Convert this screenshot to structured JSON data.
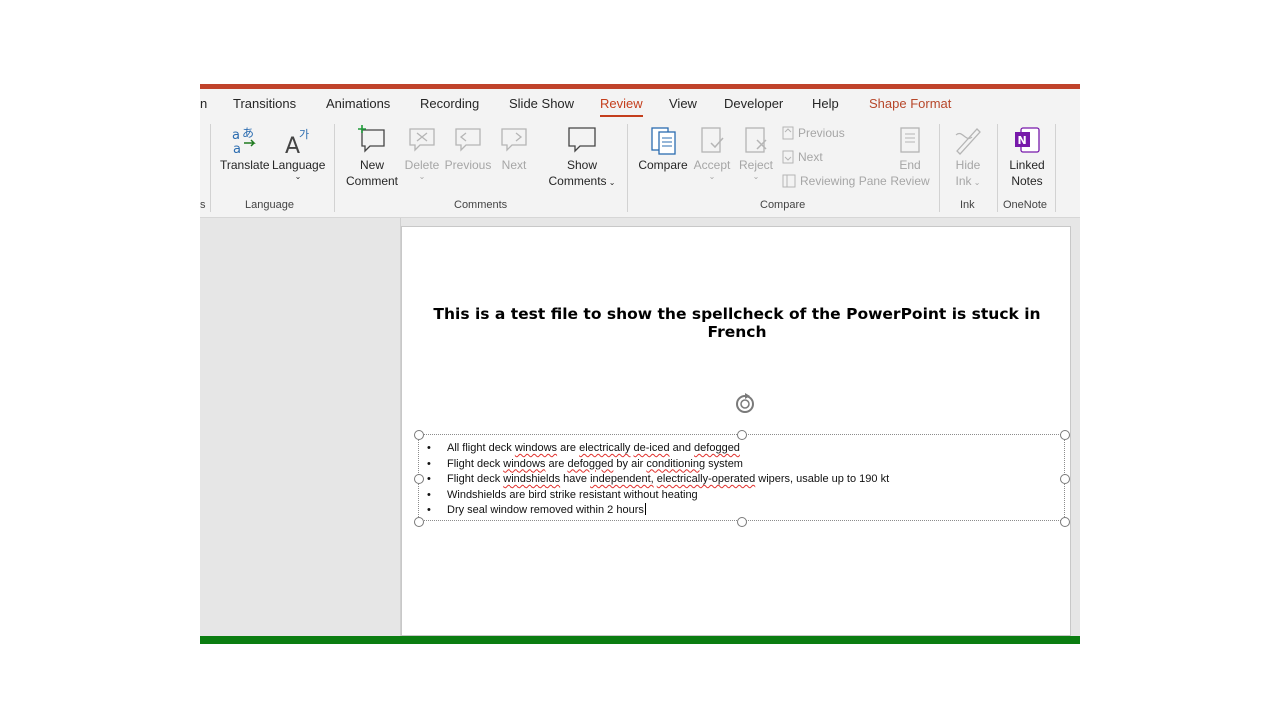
{
  "tabs": {
    "partial": "n",
    "transitions": "Transitions",
    "animations": "Animations",
    "recording": "Recording",
    "slideshow": "Slide Show",
    "review": "Review",
    "view": "View",
    "developer": "Developer",
    "help": "Help",
    "shapeformat": "Shape Format"
  },
  "ribbon": {
    "language_group": {
      "label": "Language",
      "translate": "Translate",
      "language": "Language"
    },
    "comments_group": {
      "label": "Comments",
      "new_comment_1": "New",
      "new_comment_2": "Comment",
      "delete": "Delete",
      "previous": "Previous",
      "next": "Next",
      "show_comments_1": "Show",
      "show_comments_2": "Comments"
    },
    "compare_group": {
      "label": "Compare",
      "compare": "Compare",
      "accept": "Accept",
      "reject": "Reject",
      "previous": "Previous",
      "next": "Next",
      "reviewing_pane": "Reviewing Pane",
      "end_review_1": "End",
      "end_review_2": "Review"
    },
    "ink_group": {
      "label": "Ink",
      "hide_ink_1": "Hide",
      "hide_ink_2": "Ink"
    },
    "onenote_group": {
      "label": "OneNote",
      "linked_notes_1": "Linked",
      "linked_notes_2": "Notes"
    },
    "partial_label": "s"
  },
  "slide": {
    "title": "This is a test file to show the spellcheck of the PowerPoint is stuck in French",
    "bullets": [
      [
        "All flight deck ",
        {
          "sq": "windows"
        },
        " are ",
        {
          "sq": "electrically"
        },
        " ",
        {
          "sq": "de-iced"
        },
        " and ",
        {
          "sq": "defogged"
        }
      ],
      [
        "Flight deck ",
        {
          "sq": "windows"
        },
        " are ",
        {
          "sq": "defogged"
        },
        " by air ",
        {
          "sq": "conditioning"
        },
        " system"
      ],
      [
        "Flight deck ",
        {
          "sq": "windshields"
        },
        " have ",
        {
          "sq": "independent,"
        },
        " ",
        {
          "sq": "electrically-operated"
        },
        " wipers, usable up to 190 kt"
      ],
      [
        "Windshields are bird strike resistant without heating"
      ],
      [
        "Dry seal window removed within 2 hours"
      ]
    ]
  },
  "colors": {
    "accent": "#c43e1c",
    "top_bar": "#c0432b",
    "bottom_bar": "#0b7d11",
    "spell_underline": "#e0302c"
  }
}
